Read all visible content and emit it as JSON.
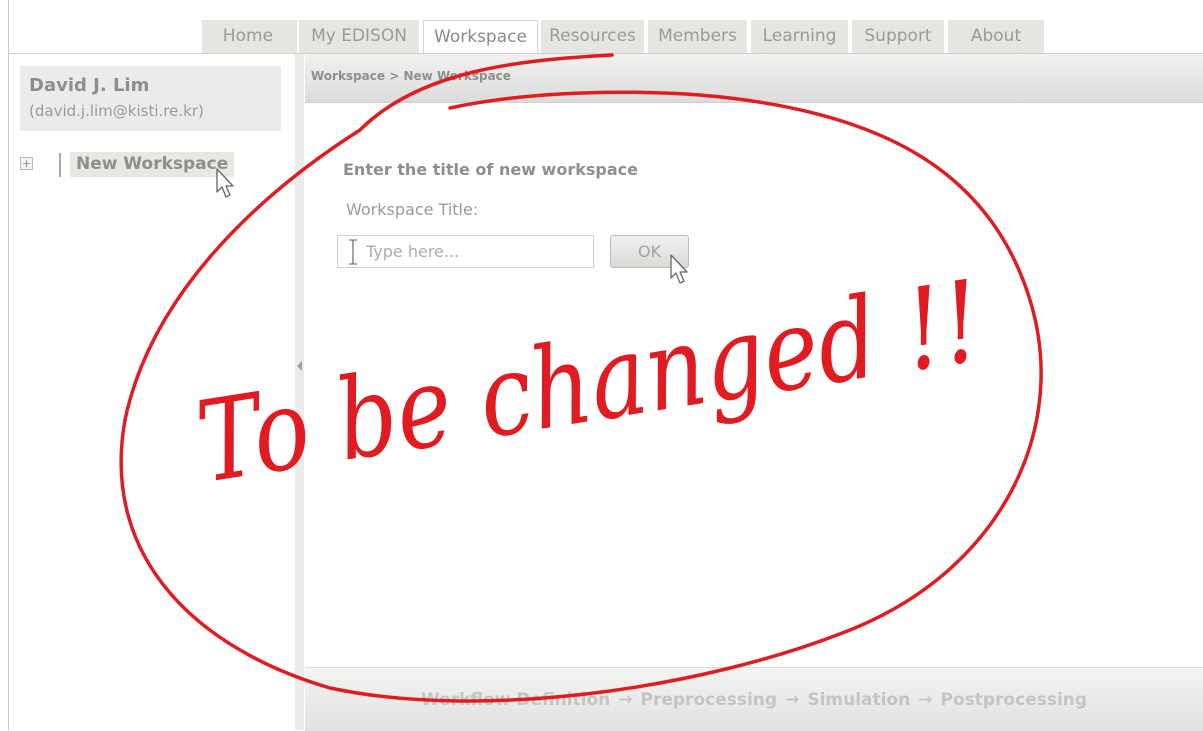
{
  "nav": {
    "tabs": [
      {
        "label": "Home"
      },
      {
        "label": "My EDISON"
      },
      {
        "label": "Workspace",
        "active": true
      },
      {
        "label": "Resources"
      },
      {
        "label": "Members"
      },
      {
        "label": "Learning"
      },
      {
        "label": "Support"
      },
      {
        "label": "About"
      }
    ]
  },
  "user": {
    "name": "David J. Lim",
    "email": "(david.j.lim@kisti.re.kr)"
  },
  "tree": {
    "items": [
      {
        "label": "New Workspace"
      }
    ]
  },
  "breadcrumb": {
    "text": "Workspace > New Workspace"
  },
  "form": {
    "prompt": "Enter the title of new workspace",
    "field_label": "Workspace Title:",
    "placeholder": "Type here...",
    "ok_label": "OK"
  },
  "workflow": {
    "steps": [
      "Workflow Definition",
      "Preprocessing",
      "Simulation",
      "Postprocessing"
    ],
    "separator": "→"
  },
  "annotation": {
    "text": "To be changed !!",
    "color": "#e01b22"
  },
  "icons": [
    "expand-icon",
    "splitter-collapse-icon",
    "text-cursor-icon",
    "mouse-pointer-icon"
  ]
}
